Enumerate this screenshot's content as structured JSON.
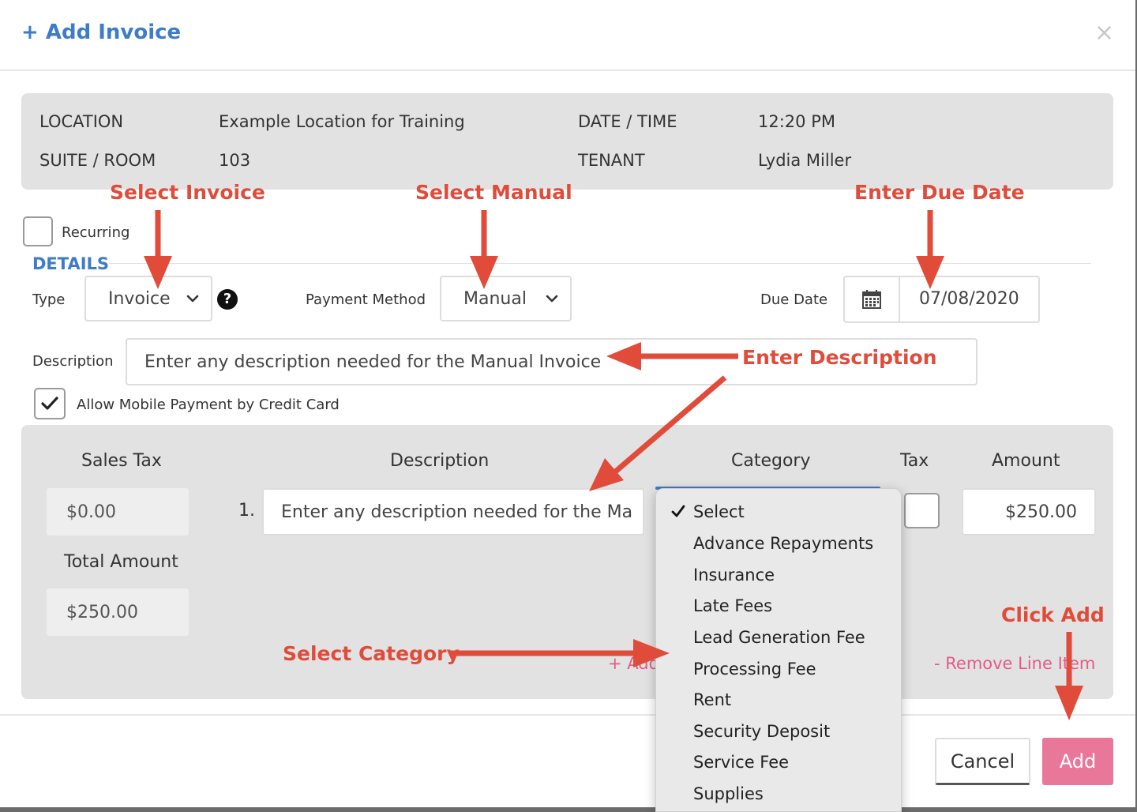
{
  "modal": {
    "title": "+ Add Invoice",
    "close_glyph": "×"
  },
  "info": {
    "location_label": "LOCATION",
    "location_value": "Example Location for Training",
    "suite_label": "SUITE / ROOM",
    "suite_value": "103",
    "datetime_label": "DATE / TIME",
    "datetime_value": "12:20 PM",
    "tenant_label": "TENANT",
    "tenant_value": "Lydia Miller"
  },
  "annotations": {
    "select_invoice": "Select Invoice",
    "select_manual": "Select Manual",
    "enter_due_date": "Enter Due Date",
    "enter_description": "Enter Description",
    "select_category": "Select Category",
    "click_add": "Click Add"
  },
  "form": {
    "recurring_label": "Recurring",
    "recurring_checked": false,
    "details_heading": "DETAILS",
    "type_label": "Type",
    "type_value": "Invoice",
    "help_glyph": "?",
    "payment_method_label": "Payment Method",
    "payment_method_value": "Manual",
    "due_date_label": "Due Date",
    "due_date_value": "07/08/2020",
    "description_label": "Description",
    "description_value": "Enter any description needed for the Manual Invoice",
    "mobile_payment_label": "Allow Mobile Payment by Credit Card",
    "mobile_payment_checked": true
  },
  "line_items": {
    "headers": {
      "sales_tax": "Sales Tax",
      "description": "Description",
      "category": "Category",
      "tax": "Tax",
      "amount": "Amount"
    },
    "sales_tax_value": "$0.00",
    "total_amount_label": "Total Amount",
    "total_amount_value": "$250.00",
    "rows": [
      {
        "number": "1.",
        "description": "Enter any description needed for the Ma",
        "tax_checked": false,
        "amount": "$250.00"
      }
    ],
    "add_line_item": "+ Add",
    "remove_line_item": "- Remove Line Item"
  },
  "category_dropdown": {
    "selected": "Select",
    "options": [
      "Select",
      "Advance Repayments",
      "Insurance",
      "Late Fees",
      "Lead Generation Fee",
      "Processing Fee",
      "Rent",
      "Security Deposit",
      "Service Fee",
      "Supplies"
    ]
  },
  "footer": {
    "cancel_label": "Cancel",
    "add_label": "Add"
  },
  "colors": {
    "accent_blue": "#3d7cc9",
    "annotation_red": "#e04b3a",
    "add_pink": "#e8779a",
    "panel_gray": "#e2e2e2"
  }
}
